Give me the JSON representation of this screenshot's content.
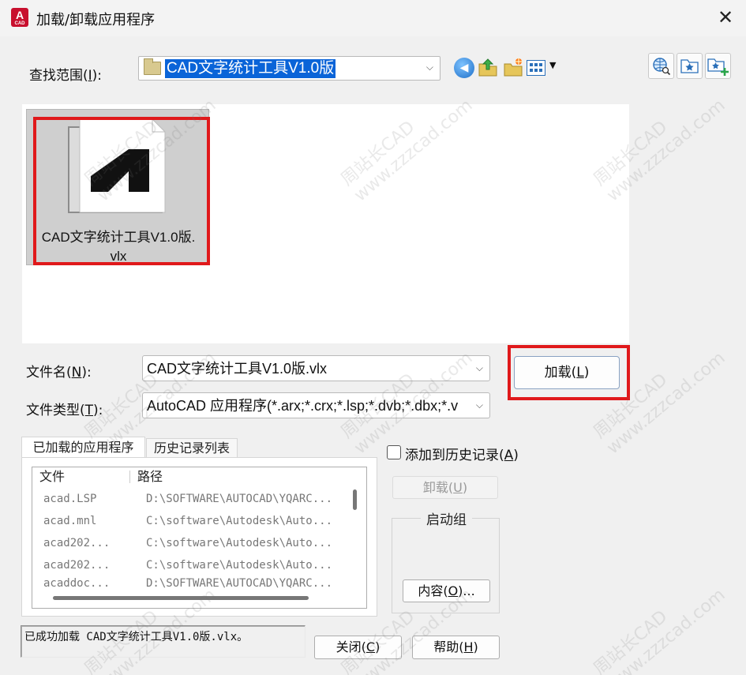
{
  "window": {
    "app_icon_text": "A",
    "app_icon_sub": "CAD",
    "title": "加载/卸载应用程序",
    "close_symbol": "✕"
  },
  "lookin": {
    "label_prefix": "查找范围(",
    "label_key": "I",
    "label_suffix": "):",
    "value": "CAD文字统计工具V1.0版",
    "arrow": "⌵"
  },
  "toolbar": {
    "back_icon": "back-icon",
    "back_glyph": "◀",
    "up_icon": "up-folder-icon",
    "new_folder_icon": "new-folder-icon",
    "views_icon": "views-menu-icon",
    "views_arrow": "▼",
    "right_icons": [
      "search-web-icon",
      "favorites-icon",
      "add-to-favorites-icon"
    ]
  },
  "file_area": {
    "file_label_line1": "CAD文字统计工具V1.0版.",
    "file_label_line2": "vlx"
  },
  "filename": {
    "label_prefix": "文件名(",
    "label_key": "N",
    "label_suffix": "):",
    "value": "CAD文字统计工具V1.0版.vlx",
    "arrow": "⌵"
  },
  "filetype": {
    "label_prefix": "文件类型(",
    "label_key": "T",
    "label_suffix": "):",
    "value": "AutoCAD 应用程序(*.arx;*.crx;*.lsp;*.dvb;*.dbx;*.v",
    "arrow": "⌵"
  },
  "load_button": {
    "prefix": "加载(",
    "key": "L",
    "suffix": ")"
  },
  "tabs": {
    "loaded": "已加载的应用程序",
    "history": "历史记录列表"
  },
  "app_list": {
    "headers": {
      "file": "文件",
      "path": "路径"
    },
    "rows": [
      {
        "file": "acad.LSP",
        "path": "D:\\SOFTWARE\\AUTOCAD\\YQARC..."
      },
      {
        "file": "acad.mnl",
        "path": "C:\\software\\Autodesk\\Auto..."
      },
      {
        "file": "acad202...",
        "path": "C:\\software\\Autodesk\\Auto..."
      },
      {
        "file": "acad202...",
        "path": "C:\\software\\Autodesk\\Auto..."
      },
      {
        "file": "acaddoc...",
        "path": "D:\\SOFTWARE\\AUTOCAD\\YQARC..."
      }
    ]
  },
  "history_checkbox": {
    "label_prefix": "添加到历史记录(",
    "label_key": "A",
    "label_suffix": ")",
    "checked": false
  },
  "unload_button": {
    "prefix": "卸载(",
    "key": "U",
    "suffix": ")"
  },
  "startup": {
    "legend": "启动组",
    "contents_prefix": "内容(",
    "contents_key": "O",
    "contents_suffix": ")..."
  },
  "status": {
    "text": "已成功加载 CAD文字统计工具V1.0版.vlx。"
  },
  "close_button": {
    "prefix": "关闭(",
    "key": "C",
    "suffix": ")"
  },
  "help_button": {
    "prefix": "帮助(",
    "key": "H",
    "suffix": ")"
  },
  "watermark": {
    "line1": "周站长CAD",
    "line2": "www.zzzcad.com"
  },
  "colors": {
    "accent_red": "#e0191b",
    "selection_blue": "#0a64d8",
    "app_icon_red": "#c8102e"
  }
}
